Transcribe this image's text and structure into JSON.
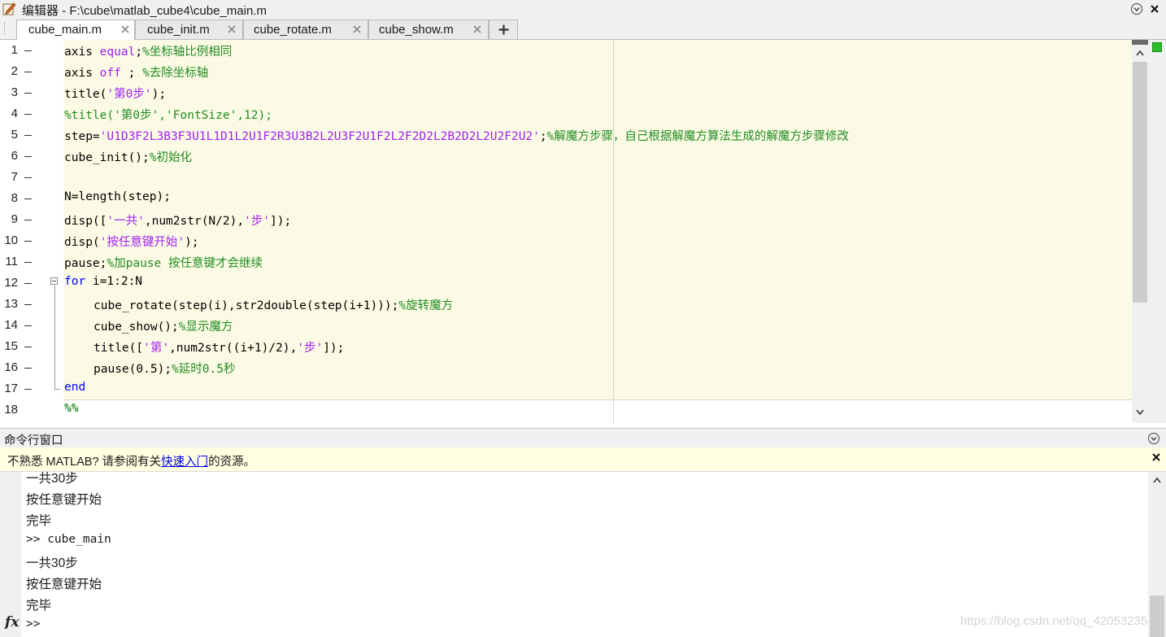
{
  "window": {
    "title": "编辑器 - F:\\cube\\matlab_cube4\\cube_main.m",
    "app_icon": "editor-pencil-icon"
  },
  "tabs": [
    {
      "label": "cube_main.m",
      "active": true
    },
    {
      "label": "cube_init.m",
      "active": false
    },
    {
      "label": "cube_rotate.m",
      "active": false
    },
    {
      "label": "cube_show.m",
      "active": false
    }
  ],
  "editor": {
    "line_numbers": [
      "1",
      "2",
      "3",
      "4",
      "5",
      "6",
      "7",
      "8",
      "9",
      "10",
      "11",
      "12",
      "13",
      "14",
      "15",
      "16",
      "17",
      "18"
    ],
    "breakpoint_dash_lines": [
      1,
      2,
      3,
      4,
      5,
      6,
      7,
      8,
      9,
      10,
      11,
      12,
      13,
      14,
      15,
      16,
      17
    ]
  },
  "code": {
    "l1": {
      "a": "axis ",
      "b": "equal",
      "c": ";",
      "d": "%坐标轴比例相同"
    },
    "l2": {
      "a": "axis ",
      "b": "off",
      "c": " ; ",
      "d": "%去除坐标轴"
    },
    "l3": {
      "a": "title(",
      "b": "'第0步'",
      "c": ");"
    },
    "l4": {
      "a": "%title('第0步','FontSize',12);"
    },
    "l5": {
      "a": "step=",
      "b": "'U1D3F2L3B3F3U1L1D1L2U1F2R3U3B2L2U3F2U1F2L2F2D2L2B2D2L2U2F2U2'",
      "c": ";",
      "d": "%解魔方步骤，自己根据解魔方算法生成的解魔方步骤修改"
    },
    "l6": {
      "a": "cube_init();",
      "b": "%初始化"
    },
    "l8": {
      "a": "N=length(step);"
    },
    "l9": {
      "a": "disp([",
      "b": "'一共'",
      "c": ",num2str(N/2),",
      "d": "'步'",
      "e": "]);"
    },
    "l10": {
      "a": "disp(",
      "b": "'按任意键开始'",
      "c": ");"
    },
    "l11": {
      "a": "pause;",
      "b": "%加pause 按任意键才会继续"
    },
    "l12": {
      "a": "for",
      "b": " i=1:2:N"
    },
    "l13": {
      "a": "cube_rotate(step(i),str2double(step(i+1)));",
      "b": "%旋转魔方"
    },
    "l14": {
      "a": "cube_show();",
      "b": "%显示魔方"
    },
    "l15": {
      "a": "title([",
      "b": "'第'",
      "c": ",num2str((i+1)/2),",
      "d": "'步'",
      "e": "]);"
    },
    "l16": {
      "a": "pause(0.5);",
      "b": "%延时0.5秒"
    },
    "l17": {
      "a": "end"
    },
    "l18": {
      "a": "%%"
    }
  },
  "command_window": {
    "title": "命令行窗口",
    "notice_before": "不熟悉 MATLAB? 请参阅有关",
    "notice_link": "快速入门",
    "notice_after": "的资源。",
    "lines": [
      "一共30步",
      "按任意键开始",
      "完毕",
      ">> cube_main",
      "一共30步",
      "按任意键开始",
      "完毕",
      ">>"
    ],
    "fx_label": "fx",
    "watermark": "https://blog.csdn.net/qq_42053235"
  },
  "colors": {
    "keyword": "#0000ff",
    "string": "#a020f0",
    "comment": "#228b22",
    "cell_background": "#fbfbe5"
  }
}
